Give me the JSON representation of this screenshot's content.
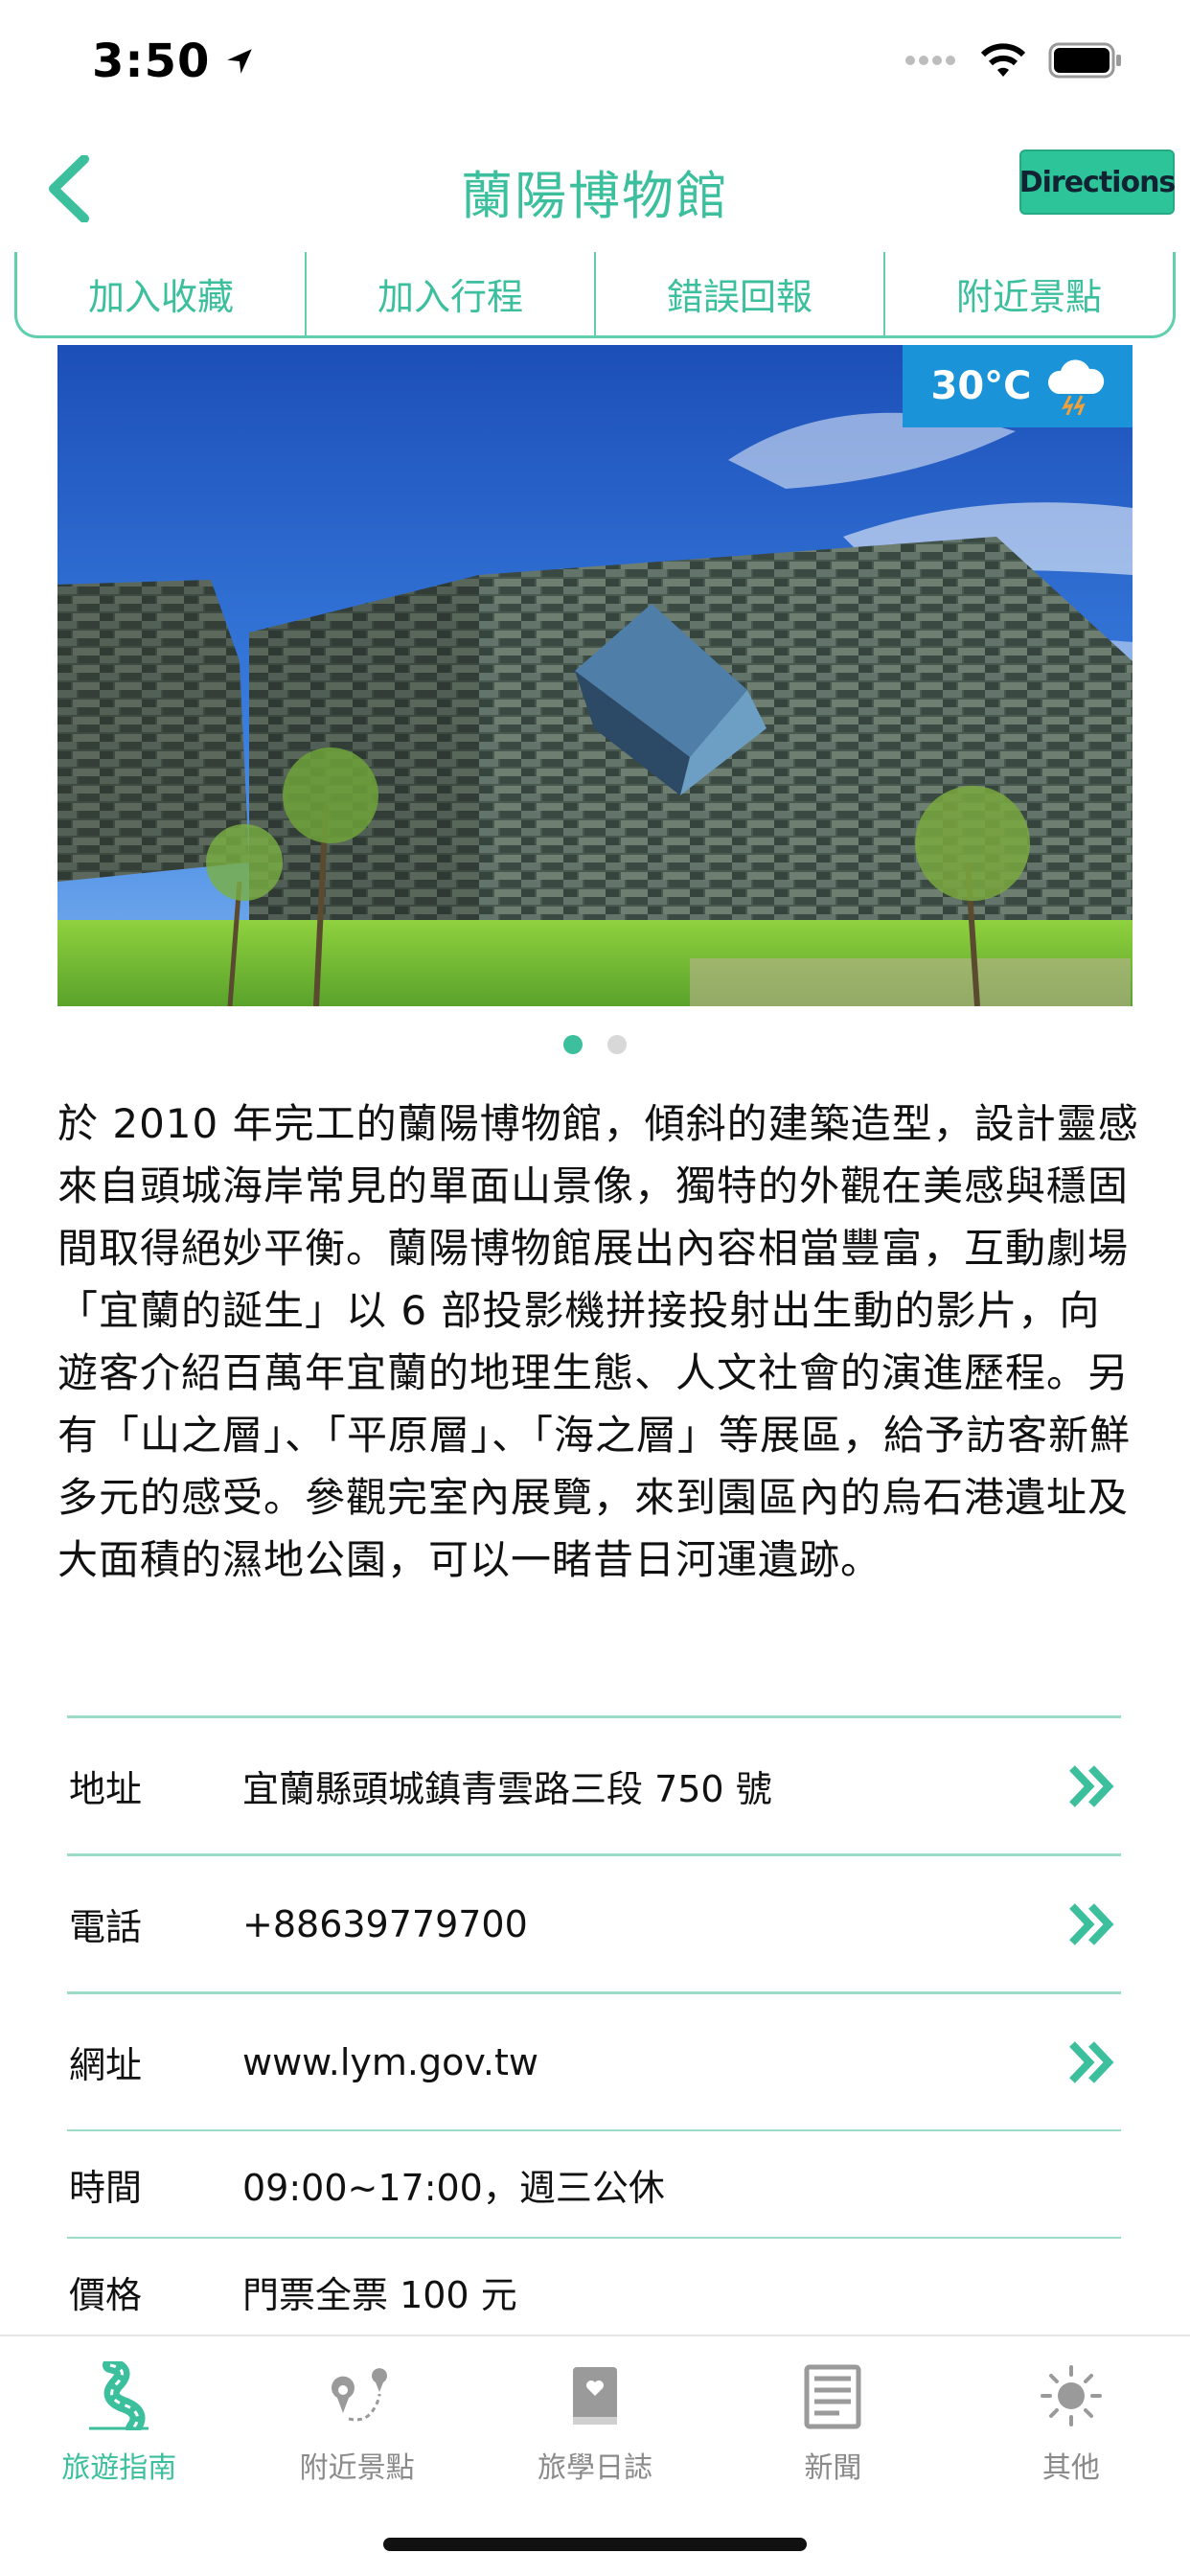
{
  "status": {
    "time": "3:50"
  },
  "nav": {
    "title": "蘭陽博物館",
    "directions_label": "Directions"
  },
  "actions": [
    "加入收藏",
    "加入行程",
    "錯誤回報",
    "附近景點"
  ],
  "weather": {
    "temperature": "30°C",
    "icon": "cloud-lightning-rain-icon"
  },
  "carousel": {
    "pages": 2,
    "current": 1
  },
  "description": "於 2010 年完工的蘭陽博物館，傾斜的建築造型，設計靈感來自頭城海岸常見的單面山景像，獨特的外觀在美感與穩固間取得絕妙平衡。蘭陽博物館展出內容相當豐富，互動劇場「宜蘭的誕生」以 6 部投影機拼接投射出生動的影片，向遊客介紹百萬年宜蘭的地理生態、人文社會的演進歷程。另有「山之層」、「平原層」、「海之層」等展區，給予訪客新鮮多元的感受。參觀完室內展覽，來到園區內的烏石港遺址及大面積的濕地公園，可以一睹昔日河運遺跡。",
  "info": {
    "address_label": "地址",
    "address": "宜蘭縣頭城鎮青雲路三段 750 號",
    "phone_label": "電話",
    "phone": "+88639779700",
    "website_label": "網址",
    "website": "www.lym.gov.tw",
    "hours_label": "時間",
    "hours": "09:00~17:00，週三公休",
    "price_label": "價格",
    "price": "門票全票 100 元"
  },
  "tabs": {
    "guide": "旅遊指南",
    "nearby": "附近景點",
    "journal": "旅學日誌",
    "news": "新聞",
    "other": "其他"
  },
  "colors": {
    "accent": "#3bbf9d",
    "directions_bg": "#2ec49a",
    "weather_bg": "#1a93d8"
  }
}
